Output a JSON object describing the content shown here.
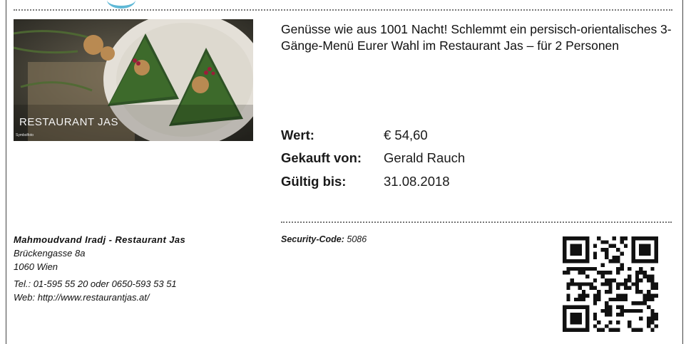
{
  "voucher": {
    "headline": "Genüsse wie aus 1001 Nacht! Schlemmt ein persisch-orientalisches 3-Gänge-Menü Eurer Wahl im Restaurant Jas – für 2 Personen",
    "image": {
      "caption": "RESTAURANT JAS",
      "credit": "Symbolfoto"
    },
    "fields": [
      {
        "label": "Wert:",
        "value": "€ 54,60"
      },
      {
        "label": "Gekauft von:",
        "value": "Gerald Rauch"
      },
      {
        "label": "Gültig bis:",
        "value": "31.08.2018"
      }
    ],
    "security": {
      "label": "Security-Code:",
      "value": "5086"
    }
  },
  "merchant": {
    "name": "Mahmoudvand Iradj - Restaurant Jas",
    "street": "Brückengasse 8a",
    "city": "1060 Wien",
    "phone": "Tel.: 01-595 55 20 oder 0650-593 53 51",
    "web": "Web: http://www.restaurantjas.at/"
  },
  "colors": {
    "accent": "#5fb8d6"
  },
  "icons": {
    "qr": "qr-code-icon"
  }
}
